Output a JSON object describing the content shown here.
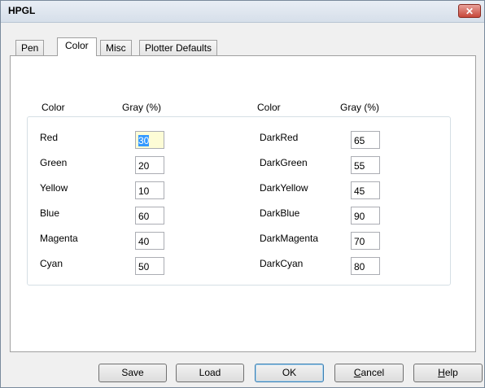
{
  "window": {
    "title": "HPGL",
    "close_glyph": "✕"
  },
  "tabs": [
    {
      "label": "Pen"
    },
    {
      "label": "Color"
    },
    {
      "label": "Misc"
    },
    {
      "label": "Plotter Defaults"
    }
  ],
  "panel": {
    "left_header_color": "Color",
    "left_header_gray": "Gray (%)",
    "right_header_color": "Color",
    "right_header_gray": "Gray (%)",
    "left": [
      {
        "name": "Red",
        "value": "30"
      },
      {
        "name": "Green",
        "value": "20"
      },
      {
        "name": "Yellow",
        "value": "10"
      },
      {
        "name": "Blue",
        "value": "60"
      },
      {
        "name": "Magenta",
        "value": "40"
      },
      {
        "name": "Cyan",
        "value": "50"
      }
    ],
    "right": [
      {
        "name": "DarkRed",
        "value": "65"
      },
      {
        "name": "DarkGreen",
        "value": "55"
      },
      {
        "name": "DarkYellow",
        "value": "45"
      },
      {
        "name": "DarkBlue",
        "value": "90"
      },
      {
        "name": "DarkMagenta",
        "value": "70"
      },
      {
        "name": "DarkCyan",
        "value": "80"
      }
    ]
  },
  "buttons": {
    "save": "Save",
    "load": "Load",
    "ok": "OK",
    "cancel_first": "C",
    "cancel_rest": "ancel",
    "help_first": "H",
    "help_rest": "elp"
  }
}
